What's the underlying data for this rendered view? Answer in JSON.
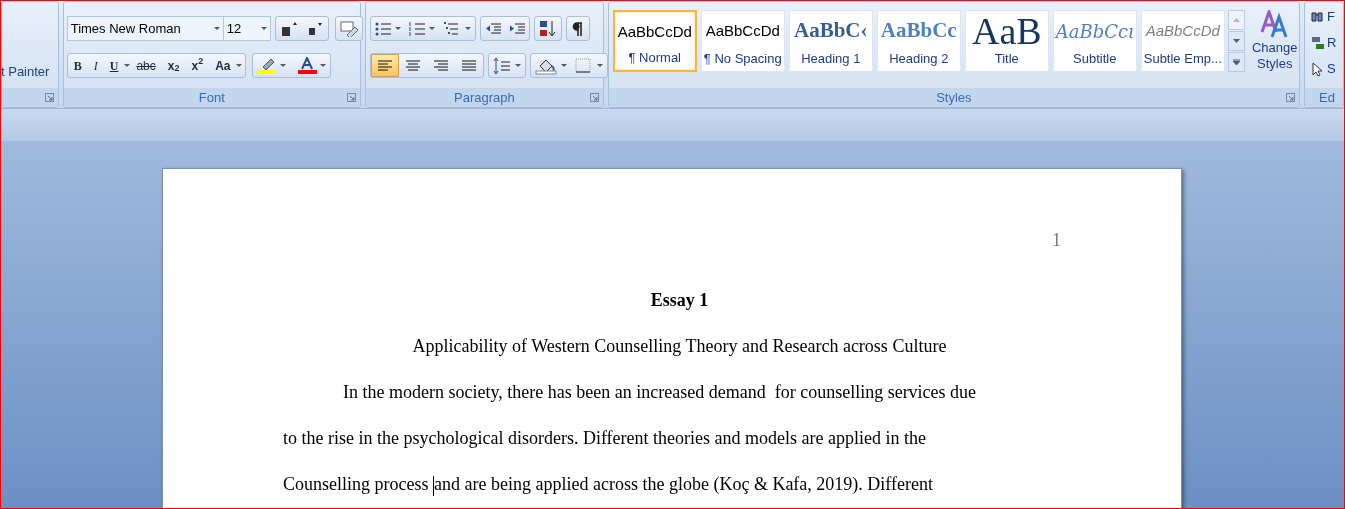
{
  "clipboard": {
    "format_painter": "t Painter"
  },
  "font": {
    "font_name": "Times New Roman",
    "font_size": "12",
    "label": "Font",
    "format_buttons": [
      {
        "text": "B",
        "kind": "bold"
      },
      {
        "text": "I",
        "kind": "italic"
      },
      {
        "text": "U",
        "kind": "underline"
      },
      {
        "text": "abc",
        "kind": "strike"
      },
      {
        "text": "x$_{2}$",
        "kind": "plain"
      },
      {
        "text": "x$^{2}$",
        "kind": "plain"
      },
      {
        "text": "Aa",
        "kind": "plain"
      }
    ],
    "highlight": true
  },
  "paragraph": {
    "label": "Paragraph",
    "alignment": [
      {
        "kind": "left",
        "selected": true
      },
      {
        "kind": "center",
        "selected": false
      },
      {
        "kind": "right",
        "selected": false
      },
      {
        "kind": "justify",
        "selected": false
      }
    ]
  },
  "styles": {
    "label": "Styles",
    "gallery": [
      {
        "preview": "AaBbCcDd",
        "label": "¶ Normal",
        "kind": "normal",
        "selected": true
      },
      {
        "preview": "AaBbCcDd",
        "label": "¶ No Spacing",
        "kind": "normal",
        "selected": false
      },
      {
        "preview": "AaBbC‹",
        "label": "Heading 1",
        "kind": "heading1",
        "selected": false
      },
      {
        "preview": "AaBbCc",
        "label": "Heading 2",
        "kind": "heading2",
        "selected": false
      },
      {
        "preview": "AaB",
        "label": "Title",
        "kind": "title",
        "selected": false
      },
      {
        "preview": "AaBbCcı",
        "label": "Subtitle",
        "kind": "subtitle",
        "selected": false
      },
      {
        "preview": "AaBbCcDd",
        "label": "Subtle Emp...",
        "kind": "subtle",
        "selected": false
      }
    ],
    "change_styles": "Change Styles"
  },
  "editing": {
    "label": "Ed",
    "items": [
      "F",
      "R",
      "S"
    ]
  },
  "document": {
    "page_number": "1",
    "title": "Essay 1",
    "subtitle": "Applicability of Western Counselling Theory and Research across Culture",
    "lines": [
      {
        "text": "In the modern society, there has been an increased demand  for counselling services due",
        "indent": true
      },
      {
        "text": "to the rise in the psychological disorders. Different theories and models are applied in the",
        "indent": false
      },
      {
        "text": "Counselling process ",
        "after_cursor": "and are being applied across the globe (Koç & Kafa, 2019). Different",
        "indent": false
      }
    ]
  }
}
